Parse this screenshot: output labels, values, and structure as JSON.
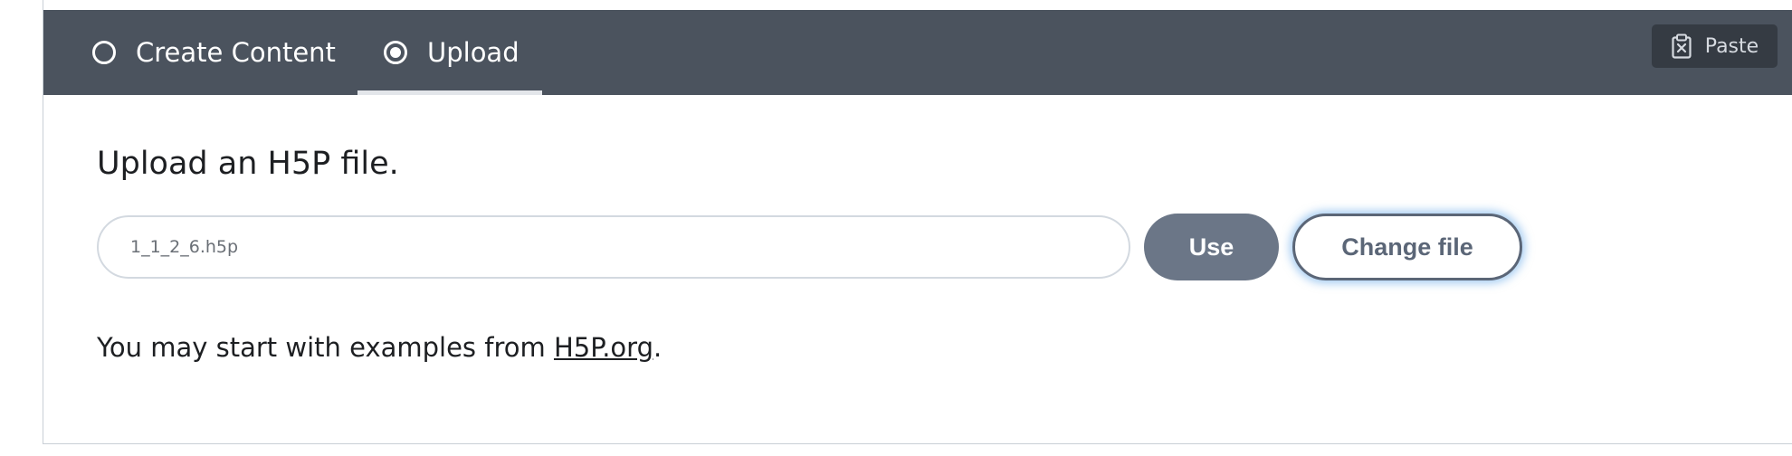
{
  "tabs": [
    {
      "label": "Create Content",
      "selected": false
    },
    {
      "label": "Upload",
      "selected": true
    }
  ],
  "toolbar": {
    "paste_label": "Paste",
    "paste_icon": "clipboard-icon"
  },
  "upload": {
    "title": "Upload an H5P file.",
    "file_value": "1_1_2_6.h5p",
    "use_label": "Use",
    "change_label": "Change file"
  },
  "examples": {
    "prefix": "You may start with examples from ",
    "link_text": "H5P.org",
    "suffix": "."
  },
  "colors": {
    "topbar": "#4b535e",
    "button_primary": "#6b7687",
    "button_outline": "#5b6677",
    "focus_glow": "#58a0e6"
  }
}
